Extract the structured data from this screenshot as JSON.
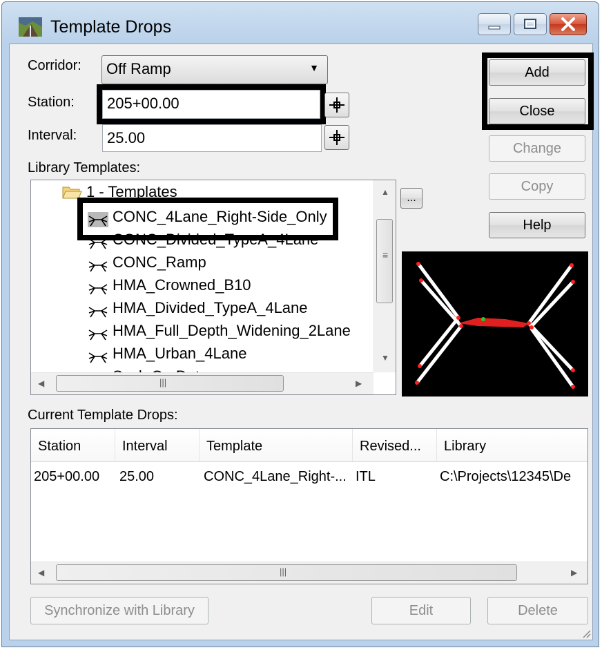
{
  "window": {
    "title": "Template Drops"
  },
  "form": {
    "corridor_label": "Corridor:",
    "corridor_value": "Off Ramp",
    "station_label": "Station:",
    "station_value": "205+00.00",
    "interval_label": "Interval:",
    "interval_value": "25.00",
    "library_label": "Library Templates:"
  },
  "buttons": {
    "add": "Add",
    "close": "Close",
    "change": "Change",
    "copy": "Copy",
    "help": "Help",
    "browse": "...",
    "synchronize": "Synchronize with Library",
    "edit": "Edit",
    "delete": "Delete"
  },
  "tree": {
    "folder": "1 - Templates",
    "items": [
      "CONC_4Lane_Right-Side_Only",
      "CONC_Divided_TypeA_4Lane",
      "CONC_Ramp",
      "HMA_Crowned_B10",
      "HMA_Divided_TypeA_4Lane",
      "HMA_Full_Depth_Widening_2Lane",
      "HMA_Urban_4Lane",
      "Scab On Detour"
    ],
    "selected_index": 0
  },
  "drops": {
    "label": "Current Template Drops:",
    "columns": [
      "Station",
      "Interval",
      "Template",
      "Revised...",
      "Library"
    ],
    "rows": [
      [
        "205+00.00",
        "25.00",
        "CONC_4Lane_Right-...",
        "ITL",
        "C:\\Projects\\12345\\De"
      ]
    ]
  },
  "colors": {
    "selection": "#000000",
    "preview_bg": "#000000",
    "window_frame": "#b9d1ea"
  }
}
